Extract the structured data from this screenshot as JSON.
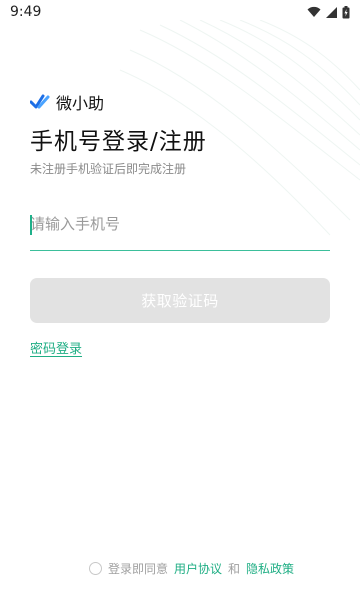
{
  "status_bar": {
    "time": "9:49",
    "icons": [
      "wifi-icon",
      "cellular-signal-icon",
      "battery-charging-icon"
    ]
  },
  "brand": {
    "name": "微小助",
    "logo_icon": "check-logo-icon"
  },
  "login": {
    "title": "手机号登录/注册",
    "subtitle": "未注册手机验证后即完成注册",
    "phone_placeholder": "请输入手机号",
    "phone_value": "",
    "get_code_label": "获取验证码",
    "password_login_label": "密码登录"
  },
  "agreement": {
    "prefix": "登录即同意",
    "user_agreement": "用户协议",
    "and": "和",
    "privacy_policy": "隐私政策"
  },
  "colors": {
    "accent": "#1fae84",
    "underline": "#3bbf9b",
    "button_disabled_bg": "#e2e2e2",
    "logo_blue": "#1e6fe6"
  }
}
